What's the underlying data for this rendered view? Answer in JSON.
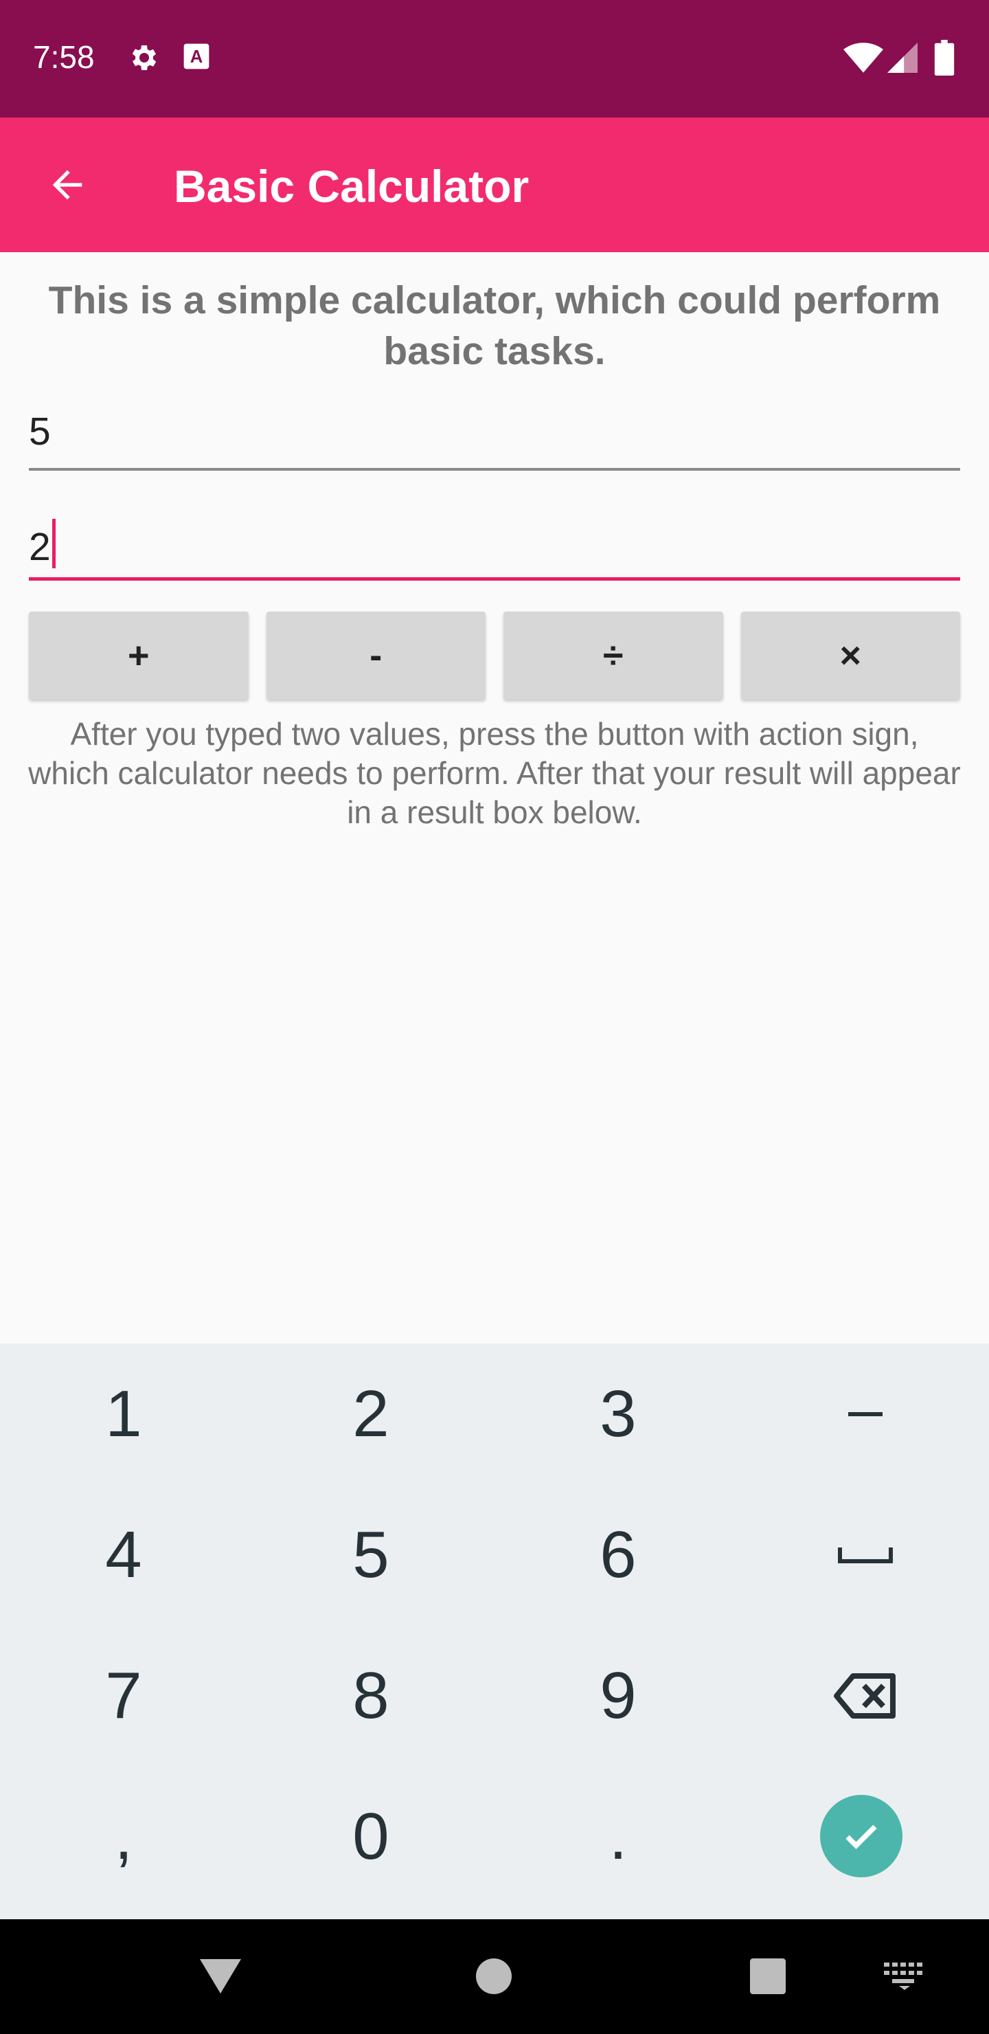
{
  "status_bar": {
    "time": "7:58",
    "left_icons": [
      "settings-icon",
      "keyboard-a-icon"
    ],
    "right_icons": [
      "wifi-icon",
      "cell-signal-icon",
      "battery-icon"
    ]
  },
  "app_bar": {
    "title": "Basic Calculator",
    "back_icon": "arrow-back-icon",
    "color": "#f22b6e"
  },
  "main": {
    "intro": "This is a simple calculator, which could perform basic tasks.",
    "field1_value": "5",
    "field2_value": "2",
    "operations": [
      "+",
      "-",
      "÷",
      "×"
    ],
    "hint": "After you typed two values, press the button with action sign, which calculator needs to perform. After that your result will appear in a result box below."
  },
  "keyboard": {
    "rows": [
      [
        "1",
        "2",
        "3",
        "–"
      ],
      [
        "4",
        "5",
        "6",
        "␣"
      ],
      [
        "7",
        "8",
        "9",
        "⌫"
      ],
      [
        ",",
        "0",
        ".",
        "✓"
      ]
    ],
    "accent": "#4db6ac"
  },
  "nav_bar": {
    "buttons": [
      "back-triangle-icon",
      "home-circle-icon",
      "recents-square-icon",
      "keyboard-switch-icon"
    ]
  }
}
